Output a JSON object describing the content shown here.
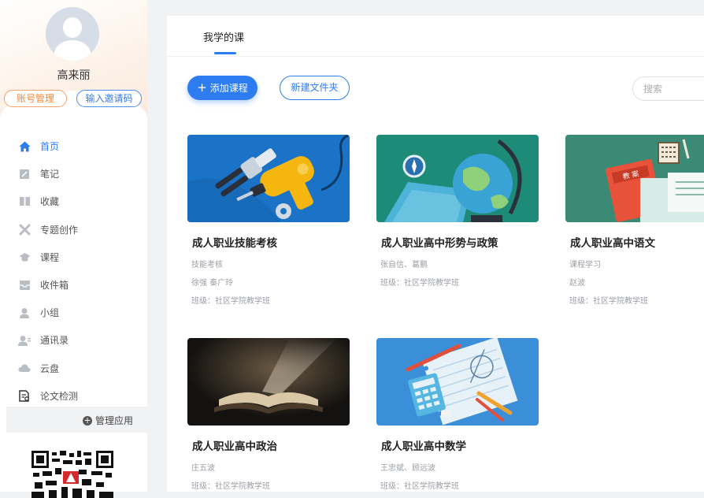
{
  "profile": {
    "name": "高来丽",
    "account_label": "账号管理",
    "invite_label": "输入邀请码"
  },
  "nav": {
    "items": [
      {
        "label": "首页",
        "icon": "home-icon",
        "active": true
      },
      {
        "label": "笔记",
        "icon": "note-icon"
      },
      {
        "label": "收藏",
        "icon": "book-icon"
      },
      {
        "label": "专题创作",
        "icon": "tools-icon"
      },
      {
        "label": "课程",
        "icon": "graduation-cap-icon"
      },
      {
        "label": "收件箱",
        "icon": "inbox-icon"
      },
      {
        "label": "小组",
        "icon": "user-icon"
      },
      {
        "label": "通讯录",
        "icon": "contacts-icon"
      },
      {
        "label": "云盘",
        "icon": "cloud-icon"
      },
      {
        "label": "论文检测",
        "icon": "document-check-icon"
      }
    ],
    "manage_label": "管理应用"
  },
  "main": {
    "tab_label": "我学的课",
    "add_course_label": "添加课程",
    "new_folder_label": "新建文件夹",
    "search_placeholder": "搜索"
  },
  "courses": [
    {
      "title": "成人职业技能考核",
      "lines": [
        "技能考核",
        "徐强  秦广玲",
        "班级：社区学院教学班"
      ],
      "image": "power-drill-and-pliers"
    },
    {
      "title": "成人职业高中形势与政策",
      "lines": [
        "张自信、葛鹏",
        "班级：社区学院教学班"
      ],
      "image": "globe-and-map"
    },
    {
      "title": "成人职业高中语文",
      "lines": [
        "课程学习",
        "赵波",
        "班级：社区学院教学班"
      ],
      "image": "textbooks-and-abacus"
    },
    {
      "title": "成人职业高中政治",
      "lines": [
        "庄五波",
        "班级：社区学院教学班"
      ],
      "image": "open-book-in-light"
    },
    {
      "title": "成人职业高中数学",
      "lines": [
        "王忠斌、顾远波",
        "班级：社区学院教学班"
      ],
      "image": "notebook-and-calculator"
    }
  ],
  "colors": {
    "accent": "#2d7cf0",
    "account_orange": "#f08a3e",
    "card1_bg": "#1a73c7",
    "card2_bg": "#1e8a78",
    "card3_bg": "#3a8a76",
    "card5_bg": "#3b8fd8"
  }
}
